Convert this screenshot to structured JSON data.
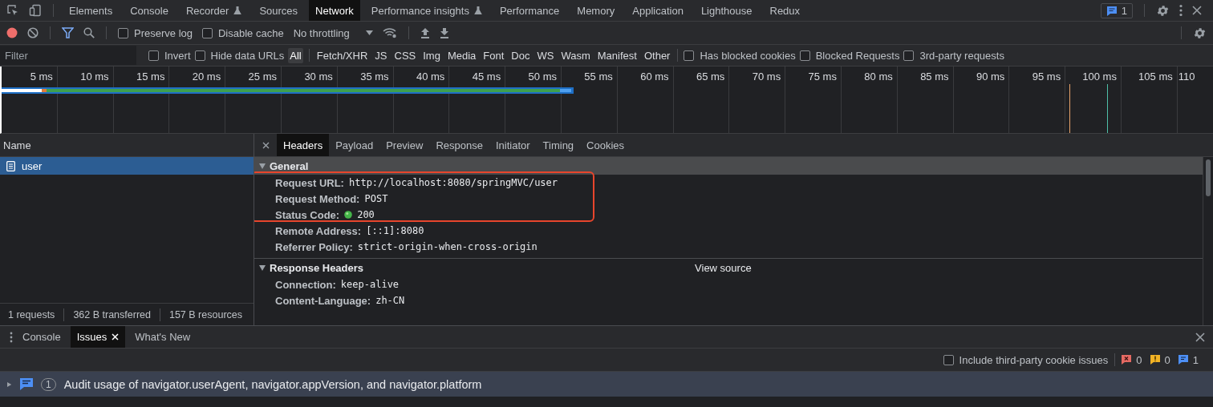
{
  "main_tabs": [
    {
      "label": "Elements",
      "selected": false,
      "experimental": false
    },
    {
      "label": "Console",
      "selected": false,
      "experimental": false
    },
    {
      "label": "Recorder",
      "selected": false,
      "experimental": true
    },
    {
      "label": "Sources",
      "selected": false,
      "experimental": false
    },
    {
      "label": "Network",
      "selected": true,
      "experimental": false
    },
    {
      "label": "Performance insights",
      "selected": false,
      "experimental": true
    },
    {
      "label": "Performance",
      "selected": false,
      "experimental": false
    },
    {
      "label": "Memory",
      "selected": false,
      "experimental": false
    },
    {
      "label": "Application",
      "selected": false,
      "experimental": false
    },
    {
      "label": "Lighthouse",
      "selected": false,
      "experimental": false
    },
    {
      "label": "Redux",
      "selected": false,
      "experimental": false
    }
  ],
  "issues_badge": "1",
  "toolbar": {
    "recording": true,
    "filter_active": true,
    "checkboxes": [
      {
        "label": "Preserve log",
        "checked": false
      },
      {
        "label": "Disable cache",
        "checked": false
      }
    ],
    "throttling": "No throttling"
  },
  "filter_bar": {
    "placeholder": "Filter",
    "checkboxes": [
      {
        "label": "Invert",
        "checked": false
      },
      {
        "label": "Hide data URLs",
        "checked": false
      }
    ],
    "types": [
      {
        "label": "All",
        "selected": true
      },
      {
        "label": "Fetch/XHR",
        "selected": false
      },
      {
        "label": "JS",
        "selected": false
      },
      {
        "label": "CSS",
        "selected": false
      },
      {
        "label": "Img",
        "selected": false
      },
      {
        "label": "Media",
        "selected": false
      },
      {
        "label": "Font",
        "selected": false
      },
      {
        "label": "Doc",
        "selected": false
      },
      {
        "label": "WS",
        "selected": false
      },
      {
        "label": "Wasm",
        "selected": false
      },
      {
        "label": "Manifest",
        "selected": false
      },
      {
        "label": "Other",
        "selected": false
      }
    ],
    "options": [
      {
        "label": "Has blocked cookies",
        "checked": false
      },
      {
        "label": "Blocked Requests",
        "checked": false
      },
      {
        "label": "3rd-party requests",
        "checked": false
      }
    ]
  },
  "timeline": {
    "ticks": [
      "5 ms",
      "10 ms",
      "15 ms",
      "20 ms",
      "25 ms",
      "30 ms",
      "35 ms",
      "40 ms",
      "45 ms",
      "50 ms",
      "55 ms",
      "60 ms",
      "65 ms",
      "70 ms",
      "75 ms",
      "80 ms",
      "85 ms",
      "90 ms",
      "95 ms",
      "100 ms",
      "105 ms",
      "110"
    ]
  },
  "requests": {
    "column": "Name",
    "rows": [
      {
        "name": "user",
        "selected": true
      }
    ],
    "summary": [
      "1 requests",
      "362 B transferred",
      "157 B resources"
    ]
  },
  "details": {
    "tabs": [
      {
        "label": "Headers",
        "selected": true
      },
      {
        "label": "Payload",
        "selected": false
      },
      {
        "label": "Preview",
        "selected": false
      },
      {
        "label": "Response",
        "selected": false
      },
      {
        "label": "Initiator",
        "selected": false
      },
      {
        "label": "Timing",
        "selected": false
      },
      {
        "label": "Cookies",
        "selected": false
      }
    ],
    "sections": [
      {
        "title": "General",
        "expanded": true,
        "selected": true,
        "rows": [
          {
            "key": "Request URL:",
            "value": "http://localhost:8080/springMVC/user",
            "kind": "text"
          },
          {
            "key": "Request Method:",
            "value": "POST",
            "kind": "text"
          },
          {
            "key": "Status Code:",
            "value": "200",
            "kind": "status"
          },
          {
            "key": "Remote Address:",
            "value": "[::1]:8080",
            "kind": "text"
          },
          {
            "key": "Referrer Policy:",
            "value": "strict-origin-when-cross-origin",
            "kind": "text"
          }
        ]
      },
      {
        "title": "Response Headers",
        "expanded": true,
        "selected": false,
        "action": "View source",
        "rows": [
          {
            "key": "Connection:",
            "value": "keep-alive",
            "kind": "text"
          },
          {
            "key": "Content-Language:",
            "value": "zh-CN",
            "kind": "text"
          }
        ]
      }
    ]
  },
  "drawer": {
    "tabs": [
      {
        "label": "Console",
        "selected": false,
        "closable": false
      },
      {
        "label": "Issues",
        "selected": true,
        "closable": true
      },
      {
        "label": "What's New",
        "selected": false,
        "closable": false
      }
    ],
    "checkbox": {
      "label": "Include third-party cookie issues",
      "checked": false
    },
    "counts": [
      {
        "kind": "error",
        "count": "0"
      },
      {
        "kind": "warning",
        "count": "0"
      },
      {
        "kind": "info",
        "count": "1"
      }
    ],
    "issues": [
      {
        "count": "1",
        "text": "Audit usage of navigator.userAgent, navigator.appVersion, and navigator.platform",
        "expanded": false
      }
    ]
  }
}
